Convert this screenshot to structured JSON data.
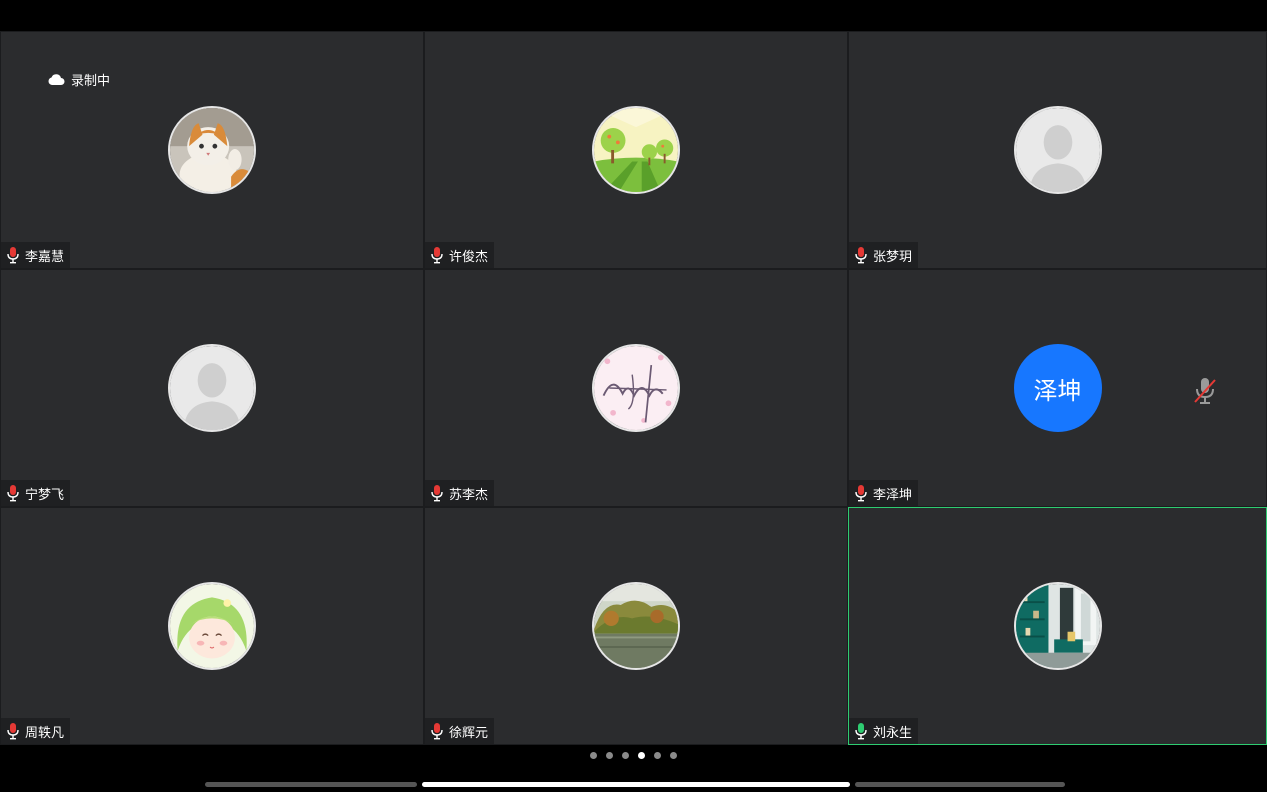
{
  "recording": {
    "label": "录制中",
    "icon": "cloud-icon"
  },
  "participants": [
    {
      "name": "李嘉慧",
      "avatar": "cat-photo",
      "mic": "unmuted-red"
    },
    {
      "name": "许俊杰",
      "avatar": "trees-illustration",
      "mic": "unmuted-red"
    },
    {
      "name": "张梦玥",
      "avatar": "default-avatar",
      "mic": "unmuted-red"
    },
    {
      "name": "宁梦飞",
      "avatar": "default-avatar",
      "mic": "unmuted-red"
    },
    {
      "name": "苏李杰",
      "avatar": "signature-art",
      "mic": "unmuted-red"
    },
    {
      "name": "李泽坤",
      "avatar_text": "泽坤",
      "avatar_color": "#1777ff",
      "mic": "unmuted-red",
      "status_icon": "muted-mic-icon"
    },
    {
      "name": "周轶凡",
      "avatar": "cartoon-girl",
      "mic": "unmuted-red"
    },
    {
      "name": "徐辉元",
      "avatar": "lake-photo",
      "mic": "unmuted-red"
    },
    {
      "name": "刘永生",
      "avatar": "room-photo",
      "mic": "active-green",
      "active": true
    }
  ],
  "pagination": {
    "total": 6,
    "current": 4
  },
  "colors": {
    "tile_bg": "#2b2c2e",
    "active_border": "#2ecc71",
    "mic_red": "#e53935",
    "mic_green": "#2ecc71",
    "avatar_blue": "#1777ff"
  }
}
